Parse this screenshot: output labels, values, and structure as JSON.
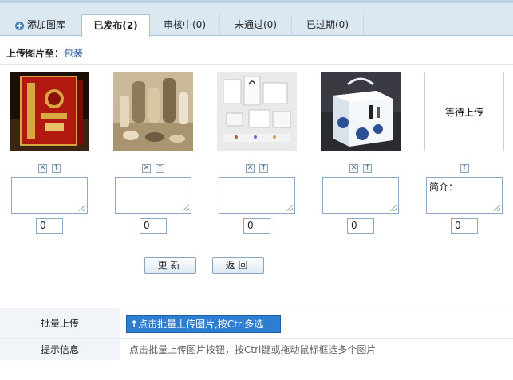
{
  "tabs": [
    {
      "label": "添加图库"
    },
    {
      "label": "已发布(2)"
    },
    {
      "label": "审核中(0)"
    },
    {
      "label": "未通过(0)"
    },
    {
      "label": "已过期(0)"
    }
  ],
  "upload_target": {
    "label": "上传图片至：",
    "link": "包装"
  },
  "slots": [
    {
      "description": "",
      "order": "0"
    },
    {
      "description": "",
      "order": "0"
    },
    {
      "description": "",
      "order": "0"
    },
    {
      "description": "",
      "order": "0"
    },
    {
      "placeholder_text": "等待上传",
      "description": "简介：",
      "order": "0"
    }
  ],
  "buttons": {
    "update": "更新",
    "back": "返回"
  },
  "batch": {
    "label": "批量上传",
    "button": "点击批量上传图片,按Ctrl多选",
    "hint_label": "提示信息",
    "hint": "点击批量上传图片按钮，按Ctrl键或拖动鼠标框选多个图片"
  },
  "colors": {
    "accent": "#2f7dd0",
    "tab_bar": "#dbe8f2",
    "link": "#1f5a96"
  }
}
